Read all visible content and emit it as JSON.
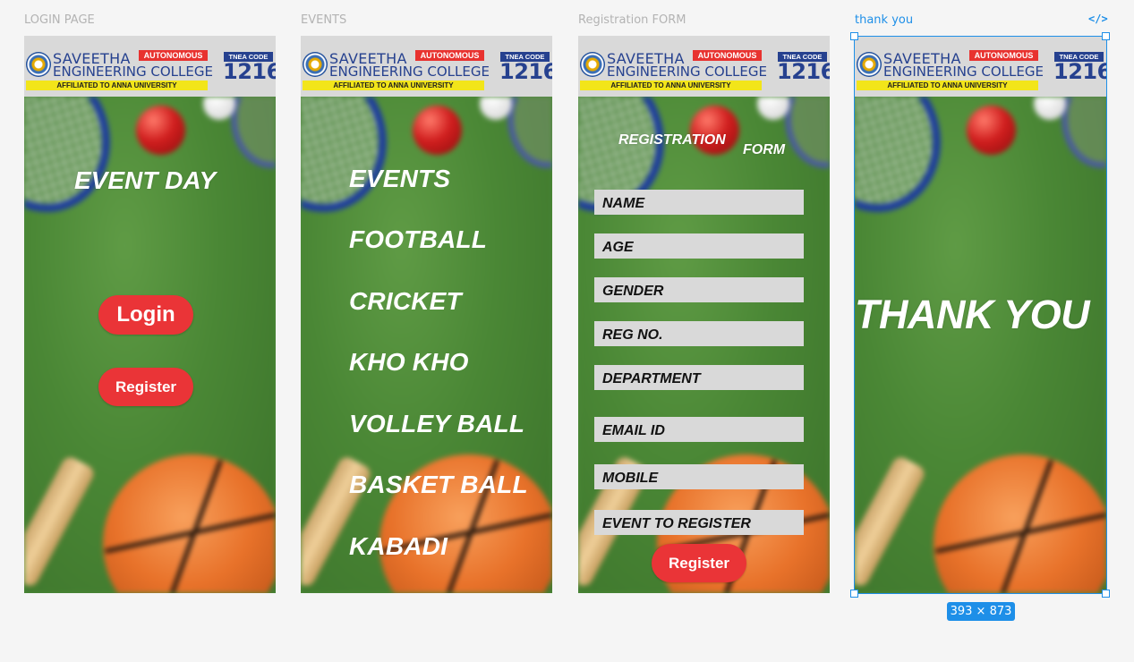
{
  "frames": {
    "login": {
      "label": "LOGIN PAGE",
      "title": "EVENT DAY",
      "login_button": "Login",
      "register_button": "Register"
    },
    "events": {
      "label": "EVENTS",
      "items": [
        "EVENTS",
        "FOOTBALL",
        "CRICKET",
        "KHO KHO",
        "VOLLEY BALL",
        "BASKET BALL",
        "KABADI"
      ]
    },
    "registration": {
      "label": "Registration FORM",
      "title_line1": "REGISTRATION",
      "title_line2": "FORM",
      "fields": [
        "NAME",
        "AGE",
        "GENDER",
        "REG NO.",
        "DEPARTMENT",
        "EMAIL ID",
        "MOBILE",
        "EVENT TO REGISTER"
      ],
      "register_button": "Register"
    },
    "thankyou": {
      "label": "thank you",
      "title": "THANK YOU"
    }
  },
  "banner": {
    "line1": "SAVEETHA",
    "line2": "ENGINEERING COLLEGE",
    "autonomous": "AUTONOMOUS",
    "affiliated": "AFFILIATED TO ANNA UNIVERSITY",
    "tnea_label": "TNEA CODE",
    "tnea_code": "1216"
  },
  "selection": {
    "dimensions": "393 × 873",
    "code_icon": "</>"
  },
  "colors": {
    "accent": "#1e8fe8",
    "button": "#ea3437",
    "field": "#d9d9d9",
    "college_blue": "#26418f",
    "autonomous_red": "#e8322f",
    "affiliated_yellow": "#f2e51a"
  }
}
